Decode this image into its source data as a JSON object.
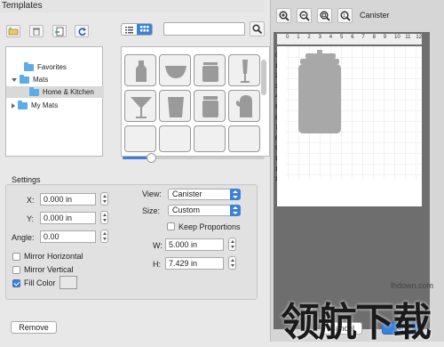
{
  "window": {
    "title": "Templates"
  },
  "tree": {
    "items": [
      {
        "label": "Favorites"
      },
      {
        "label": "Mats"
      },
      {
        "label": "Home & Kitchen"
      },
      {
        "label": "My Mats"
      }
    ]
  },
  "search": {
    "placeholder": "",
    "value": ""
  },
  "settings": {
    "heading": "Settings",
    "x_label": "X:",
    "x_value": "0.000 in",
    "y_label": "Y:",
    "y_value": "0.000 in",
    "angle_label": "Angle:",
    "angle_value": "0.00",
    "mirror_h": "Mirror Horizontal",
    "mirror_v": "Mirror Vertical",
    "fill_color": "Fill Color",
    "view_label": "View:",
    "view_value": "Canister",
    "size_label": "Size:",
    "size_value": "Custom",
    "keep_proportions": "Keep Proportions",
    "w_label": "W:",
    "w_value": "5.000 in",
    "h_label": "H:",
    "h_value": "7.429 in"
  },
  "buttons": {
    "remove": "Remove",
    "cancel": "Cancel",
    "ok": "OK"
  },
  "preview": {
    "title": "Canister",
    "ruler_top": [
      "0",
      "1",
      "2",
      "3",
      "4",
      "5",
      "6",
      "7",
      "8",
      "9",
      "10",
      "11",
      "12"
    ],
    "ruler_left": [
      "0",
      "1",
      "2",
      "3",
      "4",
      "5",
      "6",
      "7",
      "8",
      "9",
      "10",
      "11",
      "12"
    ]
  },
  "watermark": {
    "domain": "lhdown.com",
    "text": "领航下载"
  },
  "colors": {
    "accent": "#3b82d6",
    "folder": "#5aaee6",
    "canvas_bg": "#6e6e6e"
  }
}
